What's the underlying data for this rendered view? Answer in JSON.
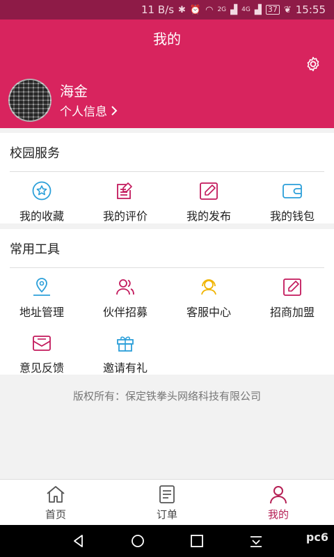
{
  "status_bar": {
    "speed": "11 B/s",
    "signal_2g": "2G",
    "signal_4g": "4G",
    "battery": "37",
    "time": "15:55"
  },
  "header": {
    "title": "我的",
    "user_name": "海金",
    "profile_link": "个人信息"
  },
  "campus_services": {
    "title": "校园服务",
    "items": [
      {
        "label": "我的收藏",
        "icon": "star-icon"
      },
      {
        "label": "我的评价",
        "icon": "review-icon"
      },
      {
        "label": "我的发布",
        "icon": "edit-icon"
      },
      {
        "label": "我的钱包",
        "icon": "wallet-icon"
      }
    ]
  },
  "common_tools": {
    "title": "常用工具",
    "items": [
      {
        "label": "地址管理",
        "icon": "location-icon"
      },
      {
        "label": "伙伴招募",
        "icon": "partner-icon"
      },
      {
        "label": "客服中心",
        "icon": "headset-icon"
      },
      {
        "label": "招商加盟",
        "icon": "edit-icon"
      },
      {
        "label": "意见反馈",
        "icon": "mail-icon"
      },
      {
        "label": "邀请有礼",
        "icon": "gift-icon"
      }
    ]
  },
  "copyright": "版权所有：保定铁拳头网络科技有限公司",
  "tabs": [
    {
      "label": "首页",
      "icon": "home-icon",
      "active": false
    },
    {
      "label": "订单",
      "icon": "order-icon",
      "active": false
    },
    {
      "label": "我的",
      "icon": "user-icon",
      "active": true
    }
  ],
  "watermark": "pc6",
  "colors": {
    "primary": "#d8245e",
    "status_bar": "#8e1b47",
    "active_tab": "#b51f54",
    "blue_icon": "#2b9fd9",
    "pink_icon": "#c2185b",
    "yellow_icon": "#f0b400"
  }
}
